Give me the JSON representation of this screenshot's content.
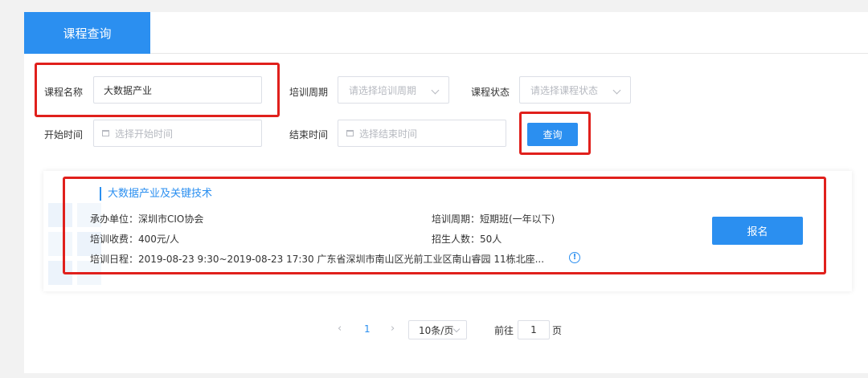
{
  "tabs": [
    {
      "label": "课程查询",
      "active": true
    }
  ],
  "search": {
    "course_name_label": "课程名称",
    "course_name_value": "大数据产业",
    "period_label": "培训周期",
    "period_placeholder": "请选择培训周期",
    "status_label": "课程状态",
    "status_placeholder": "请选择课程状态",
    "start_label": "开始时间",
    "start_placeholder": "选择开始时间",
    "end_label": "结束时间",
    "end_placeholder": "选择结束时间",
    "query_button": "查询"
  },
  "course": {
    "title": "大数据产业及关键技术",
    "org": "承办单位：深圳市CIO协会",
    "period": "培训周期：短期班(一年以下)",
    "fee": "培训收费：400元/人",
    "enroll": "招生人数：50人",
    "schedule": "培训日程：2019-08-23 9:30~2019-08-23 17:30 广东省深圳市南山区光前工业区南山睿园 11栋北座...",
    "signup_button": "报名"
  },
  "pagination": {
    "prev": "‹",
    "current_page": "1",
    "next": "›",
    "page_size": "10条/页",
    "goto_label": "前往",
    "goto_value": "1",
    "page_unit": "页"
  },
  "colors": {
    "accent": "#2b8ff0",
    "highlight": "#e0201c"
  },
  "icons": [
    "chevron-down-icon",
    "calendar-icon",
    "info-icon",
    "chevron-left-icon",
    "chevron-right-icon"
  ]
}
